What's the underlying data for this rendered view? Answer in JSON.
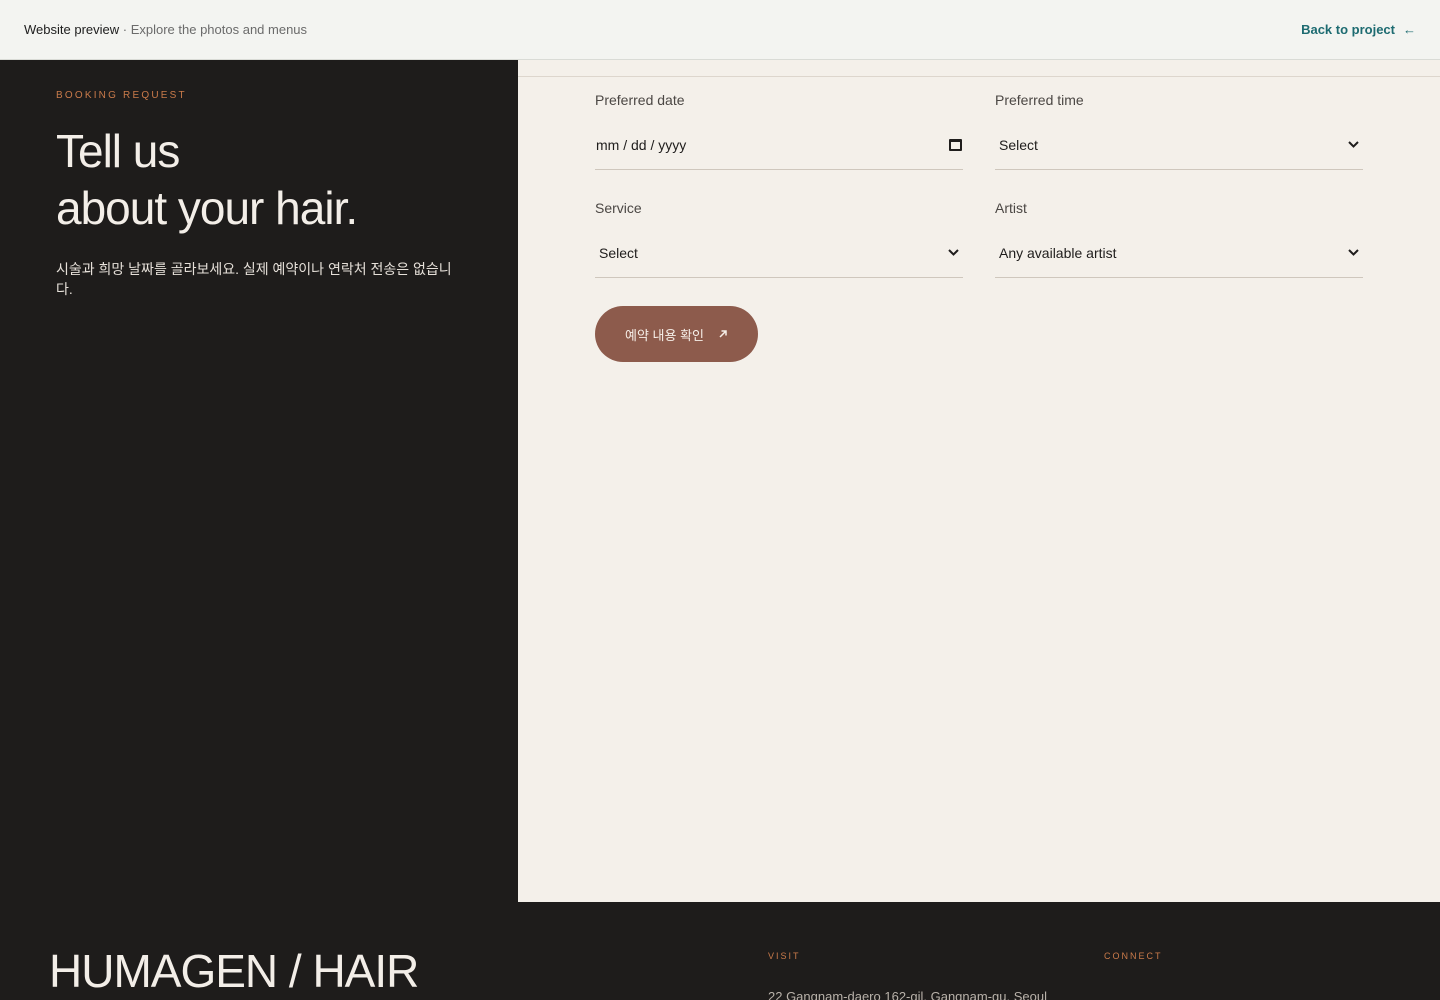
{
  "topbar": {
    "title": "Website preview",
    "subtitle": " · Explore the photos and menus",
    "back_label": "Back to project",
    "back_icon": "arrow-left-icon"
  },
  "booking": {
    "eyebrow": "BOOKING REQUEST",
    "headline_line1": "Tell us",
    "headline_line2": "about your hair.",
    "intro": "시술과 희망 날짜를 골라보세요. 실제 예약이나 연락처 전송은 없습니다."
  },
  "form": {
    "date": {
      "label": "Preferred date",
      "value": "mm / dd / yyyy",
      "icon": "calendar-icon"
    },
    "time": {
      "label": "Preferred time",
      "value": "Select",
      "icon": "chevron-down-icon"
    },
    "service": {
      "label": "Service",
      "value": "Select",
      "icon": "chevron-down-icon"
    },
    "artist": {
      "label": "Artist",
      "value": "Any available artist",
      "icon": "chevron-down-icon"
    },
    "submit_label": "예약 내용 확인",
    "submit_icon": "arrow-up-right-icon"
  },
  "footer": {
    "brand": "HUMAGEN / HAIR",
    "visit_label": "VISIT",
    "visit_text": "22 Gangnam-daero 162-gil, Gangnam-gu, Seoul",
    "connect_label": "CONNECT"
  },
  "colors": {
    "dark": "#1e1c1b",
    "cream": "#f4f0ea",
    "accent": "#c97a4a",
    "button": "#8d5b4c",
    "link": "#1d6b71"
  }
}
